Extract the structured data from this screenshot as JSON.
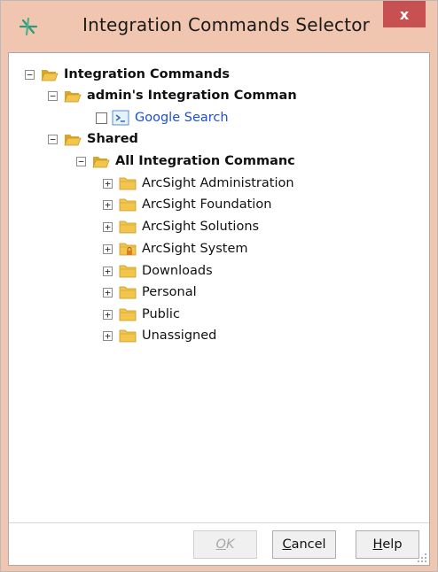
{
  "window": {
    "title": "Integration Commands Selector",
    "close_label": "x",
    "icon": "arcsight-icon",
    "titlebar_color": "#f1c6b1"
  },
  "tree": {
    "root": {
      "label": "Integration Commands",
      "expander": "−"
    },
    "admin": {
      "label": "admin's Integration Comman",
      "expander": "−"
    },
    "google": {
      "label": "Google Search",
      "checked": false
    },
    "shared": {
      "label": "Shared",
      "expander": "−"
    },
    "all": {
      "label": "All Integration Commanc",
      "expander": "−"
    },
    "children": [
      {
        "label": "ArcSight Administration",
        "expander": "+"
      },
      {
        "label": "ArcSight Foundation",
        "expander": "+"
      },
      {
        "label": "ArcSight Solutions",
        "expander": "+"
      },
      {
        "label": "ArcSight System",
        "expander": "+",
        "locked": true
      },
      {
        "label": "Downloads",
        "expander": "+"
      },
      {
        "label": "Personal",
        "expander": "+"
      },
      {
        "label": "Public",
        "expander": "+"
      },
      {
        "label": "Unassigned",
        "expander": "+"
      }
    ]
  },
  "buttons": {
    "ok": {
      "first": "O",
      "rest": "K"
    },
    "cancel": {
      "first": "C",
      "rest": "ancel"
    },
    "help": {
      "first": "H",
      "rest": "elp"
    }
  },
  "colors": {
    "folder": "#f2c64c",
    "folder_dark": "#d9a52a",
    "link": "#1a4fd8",
    "close": "#c75050"
  }
}
